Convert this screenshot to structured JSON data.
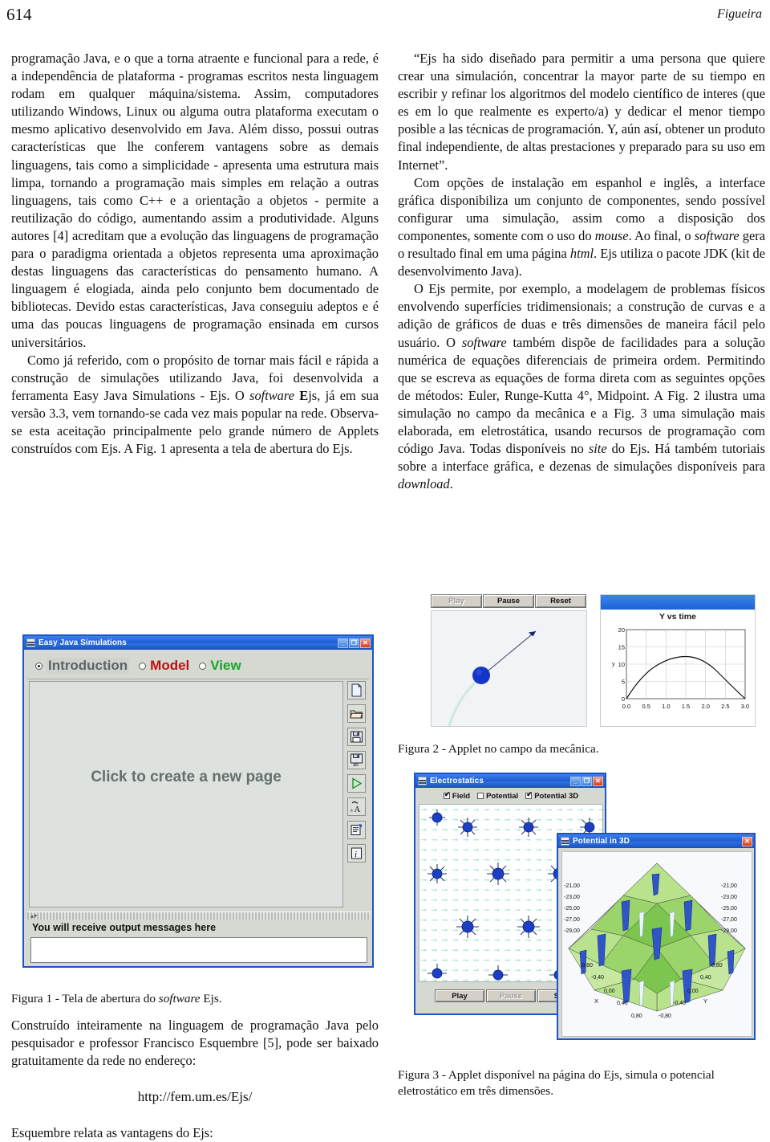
{
  "header": {
    "folio": "614",
    "author": "Figueira"
  },
  "left_column": {
    "paragraphs": [
      "programação Java, e o que a torna atraente e funcional para a rede, é a independência de plataforma - programas escritos nesta linguagem rodam em qualquer máquina/sistema.  Assim, computadores utilizando Windows, Linux ou alguma outra plataforma executam o mesmo aplicativo desenvolvido em Java. Além disso, possui outras características que lhe conferem vantagens sobre as demais linguagens, tais como a simplicidade - apresenta uma estrutura mais limpa, tornando a programação mais simples em relação a outras linguagens, tais como C++ e a orientação a objetos - permite a reutilização do código, aumentando assim a produtividade.  Alguns autores [4] acreditam que a evolução das linguagens de programação para o paradigma orientada a objetos representa uma aproximação destas linguagens das características do pensamento humano.  A linguagem é elogiada, ainda pelo conjunto bem documentado de bibliotecas.  Devido estas características, Java conseguiu adeptos e é uma das poucas linguagens de programação ensinada em cursos universitários."
    ],
    "para2_parts": {
      "a": "Como já referido, com o propósito de tornar mais fácil e rápida a construção de simulações utilizando Java, foi desenvolvida a ferramenta Easy Java Simulations - Ejs. O ",
      "software": "software",
      "b": " ",
      "ejs_bold": "E",
      "c": "js, já em sua versão 3.3, vem tornando-se cada vez mais popular na rede. Observa-se esta aceitação principalmente pelo grande número de Applets construídos com Ejs. A Fig. 1 apresenta a tela de abertura do Ejs."
    },
    "figure1_caption": {
      "a": "Figura 1 - Tela de abertura do ",
      "italic": "software",
      "b": " Ejs."
    },
    "para3": "Construído inteiramente na linguagem de programação Java pelo pesquisador e professor Francisco Esquembre [5], pode ser baixado gratuitamente da rede no endereço:",
    "url": "http://fem.um.es/Ejs/",
    "para4": "Esquembre relata as vantagens do Ejs:"
  },
  "right_column": {
    "quote": "“Ejs ha sido diseñado para permitir a uma persona que quiere crear una simulación, concentrar la mayor parte de su tiempo en escribir y refinar los algoritmos del modelo científico de interes (que es em lo que realmente es experto/a) y dedicar el menor tiempo posible a las técnicas de programación.  Y, aún así, obtener un produto final independiente, de altas prestaciones y preparado para su uso em Internet”.",
    "para2_parts": {
      "a": "Com opções de instalação em espanhol e inglês, a interface gráfica disponibiliza um conjunto de componentes, sendo possível configurar uma simulação, assim como a disposição dos componentes, somente com o uso do ",
      "mouse": "mouse",
      "b": ".  Ao final, o ",
      "software": "software",
      "c": " gera o resultado final em uma página ",
      "html": "html",
      "d": ". Ejs utiliza o pacote JDK (kit de desenvolvimento Java)."
    },
    "para3_parts": {
      "a": "O Ejs permite, por exemplo, a modelagem de problemas físicos envolvendo superfícies tridimensionais; a construção de curvas e a adição de gráficos de duas e três dimensões de maneira fácil pelo usuário. O ",
      "software": "software",
      "b": " também dispõe de facilidades para a solução numérica de equações diferenciais de primeira ordem. Permitindo que se escreva as equações de forma direta com as seguintes opções de métodos: Euler, Runge-Kutta 4°, Midpoint.  A Fig. 2 ilustra uma simulação no campo da mecânica e a Fig.  3 uma simulação mais elaborada, em eletrostática, usando recursos de programação com código Java. Todas disponíveis no ",
      "site": "site",
      "c": " do Ejs. Há também tutoriais sobre a interface gráfica, e dezenas de simulações disponíveis para ",
      "download": "download",
      "d": "."
    },
    "figure2_caption": "Figura 2 - Applet no campo da mecânica.",
    "figure3_caption": "Figura 3 - Applet disponível na página do Ejs, simula o potencial eletrostático em três dimensões."
  },
  "figure1": {
    "window_title": "Easy Java Simulations",
    "titlebar_buttons": [
      "minimize",
      "maximize",
      "close"
    ],
    "tabs": [
      {
        "label": "Introduction",
        "selected": true
      },
      {
        "label": "Model",
        "selected": false
      },
      {
        "label": "View",
        "selected": false
      }
    ],
    "canvas_hint": "Click to create a new page",
    "toolbar_icons": [
      "new-page-icon",
      "open-folder-icon",
      "save-icon",
      "save-as-icon",
      "run-icon",
      "font-search-icon",
      "properties-icon",
      "info-icon"
    ],
    "output_label": "You will receive output messages here",
    "output_value": ""
  },
  "figure2": {
    "buttons": [
      {
        "label": "Play",
        "disabled": true
      },
      {
        "label": "Pause",
        "disabled": false
      },
      {
        "label": "Reset",
        "disabled": false
      }
    ],
    "particle_color": "#1335c8",
    "trail_color": "#cfe9e0"
  },
  "figure3": {
    "window_title": "Electrostatics",
    "checkboxes": [
      {
        "label": "Field",
        "checked": true
      },
      {
        "label": "Potential",
        "checked": false
      },
      {
        "label": "Potential 3D",
        "checked": true
      }
    ],
    "buttons": [
      {
        "label": "Play",
        "disabled": false
      },
      {
        "label": "Pause",
        "disabled": true
      },
      {
        "label": "Step",
        "disabled": false
      }
    ],
    "charge_color": "#1a3fc4",
    "field_color": "#9fe4d4"
  },
  "figure3d": {
    "window_title": "Potential in 3D",
    "z_ticks": [
      "-21,00",
      "-23,00",
      "-25,00",
      "-27,00",
      "-29,00"
    ],
    "z_ticks_right": [
      "-21,00",
      "-23,00",
      "-25,00",
      "-27,00",
      "-29,00"
    ],
    "x_label": "X",
    "y_label": "Y",
    "x_ticks": [
      "-0,80",
      "-0,40",
      "0,00",
      "0,40",
      "0,80"
    ],
    "y_ticks": [
      "-0,80",
      "-0,40",
      "0,00",
      "0,40",
      "0,80"
    ],
    "surface_colors": [
      "#9ed96a",
      "#6fc44f",
      "#2f55c8",
      "#c7e8a0"
    ]
  },
  "chart_data": {
    "type": "line",
    "title": "Y vs time",
    "xlabel": "",
    "ylabel": "y",
    "x": [
      0.0,
      0.25,
      0.5,
      0.75,
      1.0,
      1.25,
      1.5,
      1.75,
      2.0,
      2.25,
      2.5,
      2.75,
      3.0
    ],
    "values": [
      0.0,
      4.3,
      7.4,
      9.7,
      11.0,
      11.5,
      11.5,
      11.0,
      9.8,
      8.0,
      5.6,
      3.0,
      0.0
    ],
    "xlim": [
      0.0,
      3.0
    ],
    "ylim": [
      0,
      20
    ],
    "xticks": [
      "0.0",
      "0.5",
      "1.0",
      "1.5",
      "2.0",
      "2.5",
      "3.0"
    ],
    "yticks": [
      "0",
      "5",
      "10",
      "15",
      "20"
    ],
    "grid": true,
    "legend": "none"
  }
}
